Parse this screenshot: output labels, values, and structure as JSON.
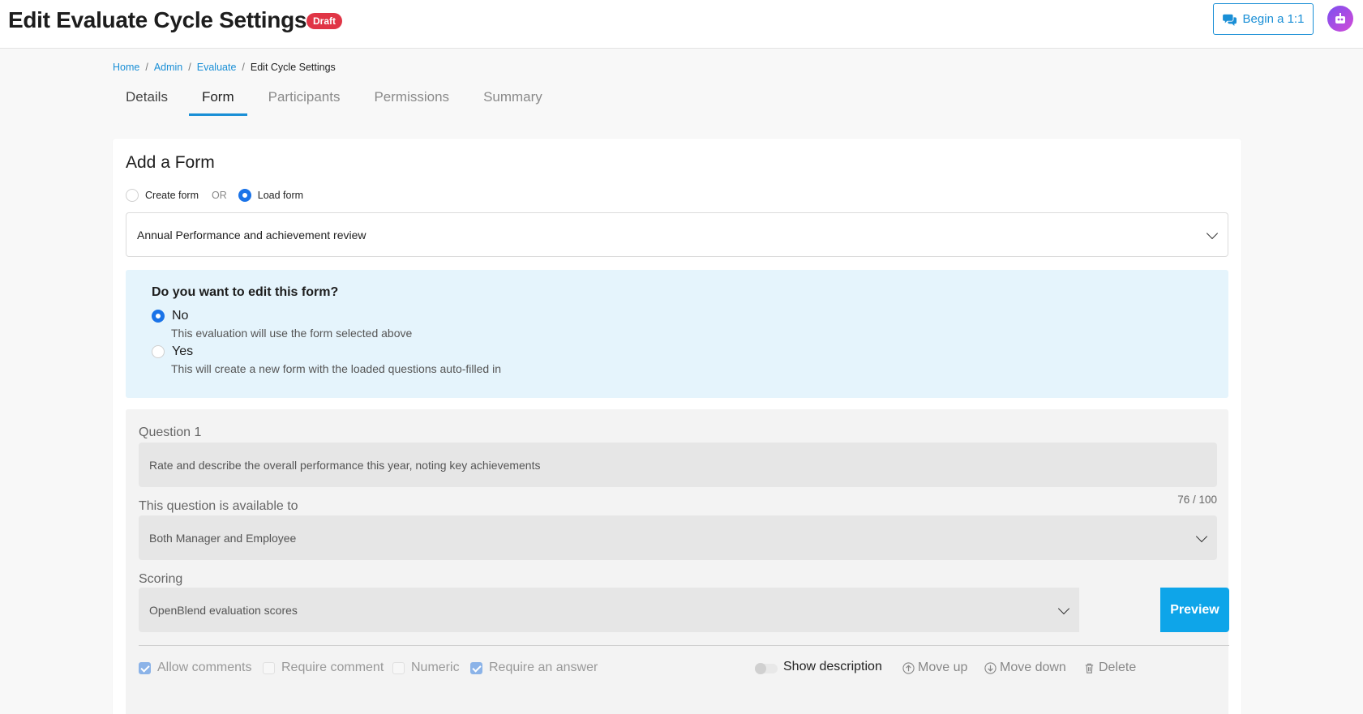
{
  "header": {
    "title": "Edit Evaluate Cycle Settings",
    "badge": "Draft",
    "begin_button": "Begin a 1:1",
    "avatar_icon": "avatar-icon"
  },
  "breadcrumb": {
    "items": [
      "Home",
      "Admin",
      "Evaluate"
    ],
    "separator": "/",
    "current": "Edit Cycle Settings"
  },
  "tabs": [
    {
      "label": "Details"
    },
    {
      "label": "Form",
      "active": true
    },
    {
      "label": "Participants"
    },
    {
      "label": "Permissions"
    },
    {
      "label": "Summary"
    }
  ],
  "add_form": {
    "title": "Add a Form",
    "create_label": "Create form",
    "or_label": "OR",
    "load_label": "Load form",
    "selected_option": "load",
    "selected_form": "Annual Performance and achievement review"
  },
  "edit_prompt": {
    "question": "Do you want to edit this form?",
    "no_label": "No",
    "no_desc": "This evaluation will use the form selected above",
    "yes_label": "Yes",
    "yes_desc": "This will create a new form with the loaded questions auto-filled in",
    "selected": "No"
  },
  "question_card": {
    "question_label": "Question 1",
    "question_text": "Rate and describe the overall performance this year, noting key achievements",
    "char_count": "76 / 100",
    "available_label": "This question is available to",
    "available_value": "Both Manager and Employee",
    "scoring_label": "Scoring",
    "scoring_value": "OpenBlend evaluation scores",
    "preview_button": "Preview",
    "options": {
      "allow_comments": {
        "label": "Allow comments",
        "checked": true
      },
      "require_comment": {
        "label": "Require comment",
        "checked": false
      },
      "numeric": {
        "label": "Numeric",
        "checked": false
      },
      "require_answer": {
        "label": "Require an answer",
        "checked": true
      }
    },
    "show_description": {
      "label": "Show description",
      "on": false
    },
    "move_up": "Move up",
    "move_down": "Move down",
    "delete": "Delete"
  },
  "colors": {
    "accent": "#1a8fd6",
    "draft_badge": "#e03546",
    "info_background": "#e5f4fc",
    "preview_button": "#0ea5e9"
  }
}
